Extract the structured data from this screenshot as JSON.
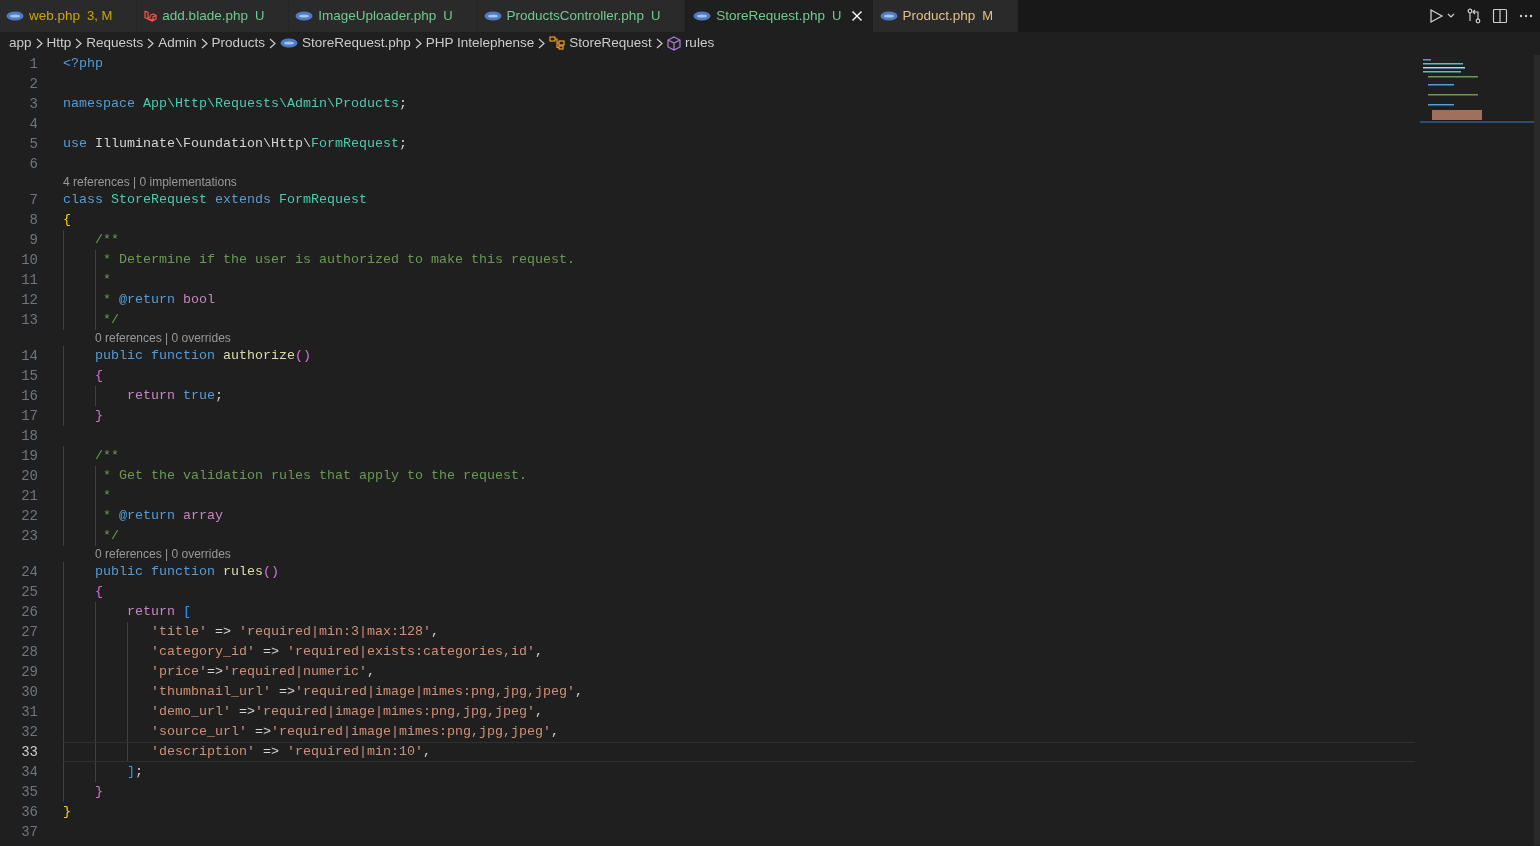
{
  "tabs": [
    {
      "label": "web.php",
      "status": "3, M",
      "kind": "php",
      "color": "#cca700",
      "selected": false
    },
    {
      "label": "add.blade.php",
      "status": "U",
      "kind": "laravel",
      "color": "#73c991",
      "selected": false
    },
    {
      "label": "ImageUploader.php",
      "status": "U",
      "kind": "php",
      "color": "#73c991",
      "selected": false
    },
    {
      "label": "ProductsController.php",
      "status": "U",
      "kind": "php",
      "color": "#73c991",
      "selected": false
    },
    {
      "label": "StoreRequest.php",
      "status": "U",
      "kind": "php",
      "color": "#73c991",
      "selected": true
    },
    {
      "label": "Product.php",
      "status": "M",
      "kind": "php",
      "color": "#e2c08d",
      "selected": false
    }
  ],
  "breadcrumb": [
    {
      "label": "app"
    },
    {
      "label": "Http"
    },
    {
      "label": "Requests"
    },
    {
      "label": "Admin"
    },
    {
      "label": "Products"
    },
    {
      "label": "StoreRequest.php",
      "kind": "php"
    },
    {
      "label": "PHP Intelephense"
    },
    {
      "label": "StoreRequest",
      "kind": "class"
    },
    {
      "label": "rules",
      "kind": "method"
    }
  ],
  "lines": [
    {
      "number": "1",
      "current": false,
      "tokens": [
        {
          "kind": "tag",
          "text": "<?php"
        }
      ]
    },
    {
      "number": "2",
      "current": false
    },
    {
      "number": "3",
      "current": false,
      "tokens": [
        {
          "kind": "kw",
          "text": "namespace "
        },
        {
          "kind": "type",
          "text": "App\\Http\\Requests\\Admin\\Products"
        },
        {
          "kind": "plain",
          "text": ";"
        }
      ]
    },
    {
      "number": "4",
      "current": false
    },
    {
      "number": "5",
      "current": false,
      "tokens": [
        {
          "kind": "kw",
          "text": "use"
        },
        {
          "kind": "plain",
          "text": " Illuminate\\Foundation\\Http\\"
        },
        {
          "kind": "type",
          "text": "FormRequest"
        },
        {
          "kind": "plain",
          "text": ";"
        }
      ]
    },
    {
      "number": "6",
      "current": false
    },
    {
      "number": "7",
      "current": false,
      "lens": "4 references | 0 implementations",
      "tokens": [
        {
          "kind": "kw",
          "text": "class "
        },
        {
          "kind": "type",
          "text": "StoreRequest "
        },
        {
          "kind": "kw",
          "text": "extends "
        },
        {
          "kind": "type",
          "text": "FormRequest"
        }
      ]
    },
    {
      "number": "8",
      "current": false,
      "tokens": [
        {
          "kind": "brace1",
          "text": "{"
        }
      ]
    },
    {
      "number": "9",
      "current": false,
      "tokens": [
        {
          "kind": "comment",
          "text": "    /**"
        }
      ]
    },
    {
      "number": "10",
      "current": false,
      "tokens": [
        {
          "kind": "comment",
          "text": "     * Determine if the user is authorized to make this request."
        }
      ]
    },
    {
      "number": "11",
      "current": false,
      "tokens": [
        {
          "kind": "comment",
          "text": "     *"
        }
      ]
    },
    {
      "number": "12",
      "current": false,
      "tokens": [
        {
          "kind": "comment",
          "text": "     * "
        },
        {
          "kind": "kw",
          "text": "@return "
        },
        {
          "kind": "control",
          "text": "bool"
        }
      ]
    },
    {
      "number": "13",
      "current": false,
      "tokens": [
        {
          "kind": "comment",
          "text": "     */"
        }
      ]
    },
    {
      "number": "14",
      "current": false,
      "lens": "0 references | 0 overrides",
      "tokens": [
        {
          "kind": "kw",
          "text": "    public function "
        },
        {
          "kind": "fn",
          "text": "authorize"
        },
        {
          "kind": "brace2",
          "text": "()"
        }
      ]
    },
    {
      "number": "15",
      "current": false,
      "tokens": [
        {
          "kind": "brace2",
          "text": "    {"
        }
      ]
    },
    {
      "number": "16",
      "current": false,
      "tokens": [
        {
          "kind": "control",
          "text": "        return "
        },
        {
          "kind": "kw",
          "text": "true"
        },
        {
          "kind": "plain",
          "text": ";"
        }
      ]
    },
    {
      "number": "17",
      "current": false,
      "tokens": [
        {
          "kind": "brace2",
          "text": "    }"
        }
      ]
    },
    {
      "number": "18",
      "current": false
    },
    {
      "number": "19",
      "current": false,
      "tokens": [
        {
          "kind": "comment",
          "text": "    /**"
        }
      ]
    },
    {
      "number": "20",
      "current": false,
      "tokens": [
        {
          "kind": "comment",
          "text": "     * Get the validation rules that apply to the request."
        }
      ]
    },
    {
      "number": "21",
      "current": false,
      "tokens": [
        {
          "kind": "comment",
          "text": "     *"
        }
      ]
    },
    {
      "number": "22",
      "current": false,
      "tokens": [
        {
          "kind": "comment",
          "text": "     * "
        },
        {
          "kind": "kw",
          "text": "@return "
        },
        {
          "kind": "control",
          "text": "array"
        }
      ]
    },
    {
      "number": "23",
      "current": false,
      "tokens": [
        {
          "kind": "comment",
          "text": "     */"
        }
      ]
    },
    {
      "number": "24",
      "current": false,
      "lens": "0 references | 0 overrides",
      "tokens": [
        {
          "kind": "kw",
          "text": "    public function "
        },
        {
          "kind": "fn",
          "text": "rules"
        },
        {
          "kind": "brace2",
          "text": "()"
        }
      ]
    },
    {
      "number": "25",
      "current": false,
      "tokens": [
        {
          "kind": "brace2",
          "text": "    {"
        }
      ]
    },
    {
      "number": "26",
      "current": false,
      "tokens": [
        {
          "kind": "control",
          "text": "        return "
        },
        {
          "kind": "brace3",
          "text": "["
        }
      ]
    },
    {
      "number": "27",
      "current": false,
      "tokens": [
        {
          "kind": "str",
          "text": "           'title'"
        },
        {
          "kind": "plain",
          "text": " => "
        },
        {
          "kind": "str",
          "text": "'required|min:3|max:128'"
        },
        {
          "kind": "plain",
          "text": ","
        }
      ]
    },
    {
      "number": "28",
      "current": false,
      "tokens": [
        {
          "kind": "str",
          "text": "           'category_id'"
        },
        {
          "kind": "plain",
          "text": " => "
        },
        {
          "kind": "str",
          "text": "'required|exists:categories,id'"
        },
        {
          "kind": "plain",
          "text": ","
        }
      ]
    },
    {
      "number": "29",
      "current": false,
      "tokens": [
        {
          "kind": "str",
          "text": "           'price'"
        },
        {
          "kind": "plain",
          "text": "=>"
        },
        {
          "kind": "str",
          "text": "'required|numeric'"
        },
        {
          "kind": "plain",
          "text": ","
        }
      ]
    },
    {
      "number": "30",
      "current": false,
      "tokens": [
        {
          "kind": "str",
          "text": "           'thumbnail_url'"
        },
        {
          "kind": "plain",
          "text": " =>"
        },
        {
          "kind": "str",
          "text": "'required|image|mimes:png,jpg,jpeg'"
        },
        {
          "kind": "plain",
          "text": ","
        }
      ]
    },
    {
      "number": "31",
      "current": false,
      "tokens": [
        {
          "kind": "str",
          "text": "           'demo_url'"
        },
        {
          "kind": "plain",
          "text": " =>"
        },
        {
          "kind": "str",
          "text": "'required|image|mimes:png,jpg,jpeg'"
        },
        {
          "kind": "plain",
          "text": ","
        }
      ]
    },
    {
      "number": "32",
      "current": false,
      "tokens": [
        {
          "kind": "str",
          "text": "           'source_url'"
        },
        {
          "kind": "plain",
          "text": " =>"
        },
        {
          "kind": "str",
          "text": "'required|image|mimes:png,jpg,jpeg'"
        },
        {
          "kind": "plain",
          "text": ","
        }
      ]
    },
    {
      "number": "33",
      "current": true,
      "tokens": [
        {
          "kind": "str",
          "text": "           'description'"
        },
        {
          "kind": "plain",
          "text": " => "
        },
        {
          "kind": "str",
          "text": "'required|min:10'"
        },
        {
          "kind": "plain",
          "text": ","
        }
      ]
    },
    {
      "number": "34",
      "current": false,
      "tokens": [
        {
          "kind": "brace3",
          "text": "        ]"
        },
        {
          "kind": "plain",
          "text": ";"
        }
      ]
    },
    {
      "number": "35",
      "current": false,
      "tokens": [
        {
          "kind": "brace2",
          "text": "    }"
        }
      ]
    },
    {
      "number": "36",
      "current": false,
      "tokens": [
        {
          "kind": "brace1",
          "text": "}"
        }
      ]
    },
    {
      "number": "37",
      "current": false
    }
  ]
}
